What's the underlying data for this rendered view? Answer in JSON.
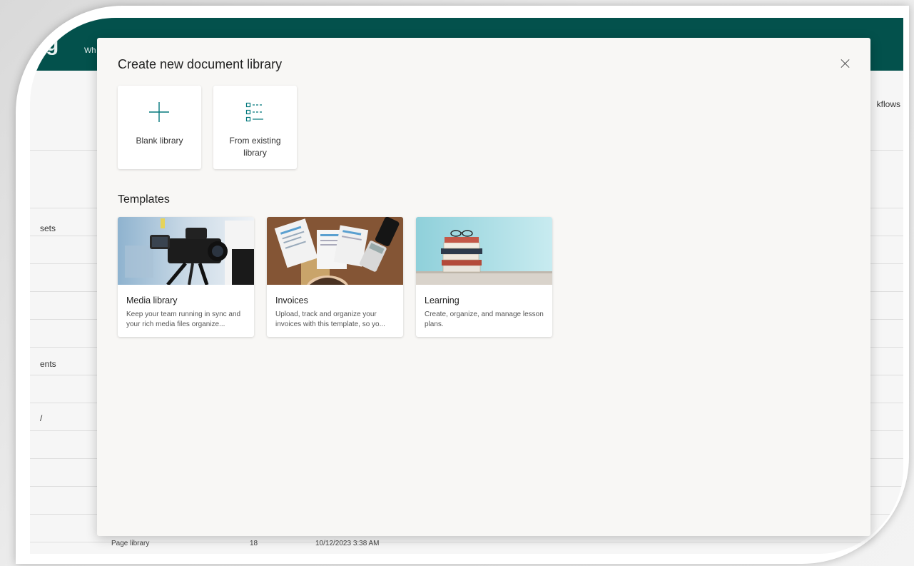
{
  "background_page": {
    "suite_logo_text": "g",
    "suite_nav_text": "Wh",
    "right_label": "kflows",
    "left_labels": [
      "sets",
      "ents",
      "/"
    ],
    "footer_row": {
      "type": "Page library",
      "count": "18",
      "modified": "10/12/2023 3:38 AM"
    }
  },
  "modal": {
    "title": "Create new document library",
    "close_icon": "close-icon",
    "options": [
      {
        "label": "Blank library",
        "icon": "plus-icon"
      },
      {
        "label": "From existing library",
        "icon": "list-icon"
      }
    ],
    "templates_heading": "Templates",
    "templates": [
      {
        "name": "Media library",
        "description": "Keep your team running in sync and your rich media files organize...",
        "thumbnail": "camera-image"
      },
      {
        "name": "Invoices",
        "description": "Upload, track and organize your invoices with this template, so yo...",
        "thumbnail": "invoices-image"
      },
      {
        "name": "Learning",
        "description": "Create, organize, and manage lesson plans.",
        "thumbnail": "books-image"
      }
    ]
  },
  "colors": {
    "suite_bar": "#03514c",
    "accent": "#03787c",
    "modal_bg": "#f8f7f5"
  }
}
